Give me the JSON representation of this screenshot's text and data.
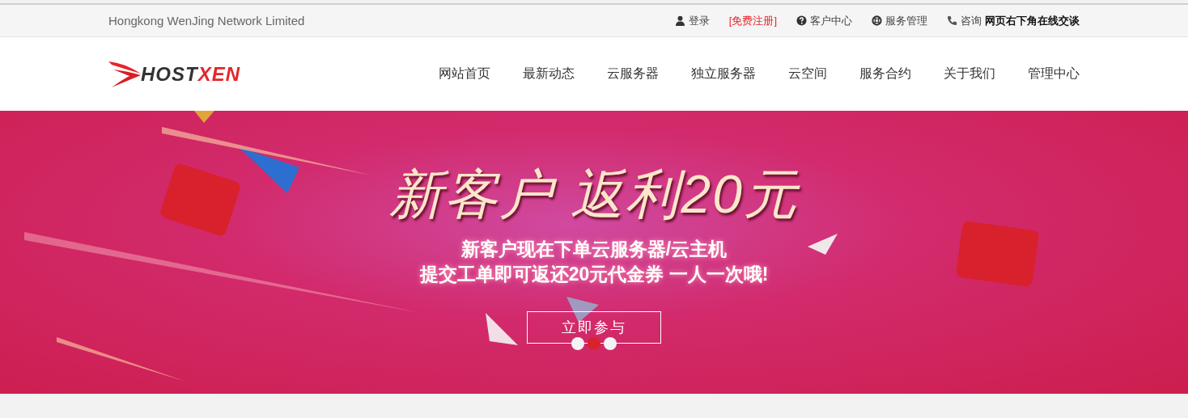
{
  "topbar": {
    "company": "Hongkong WenJing Network Limited",
    "links": [
      {
        "kind": "user",
        "label": "登录"
      },
      {
        "kind": "register",
        "label": "[免费注册]"
      },
      {
        "kind": "help",
        "label": "客户中心"
      },
      {
        "kind": "lifebuoy",
        "label": "服务管理"
      },
      {
        "kind": "phone",
        "label": "咨询",
        "strong": "网页右下角在线交谈"
      }
    ]
  },
  "logo": {
    "part1": "HOST",
    "part2": "XEN"
  },
  "nav": [
    "网站首页",
    "最新动态",
    "云服务器",
    "独立服务器",
    "云空间",
    "服务合约",
    "关于我们",
    "管理中心"
  ],
  "banner": {
    "headline": "新客户 返利20元",
    "line1": "新客户现在下单云服务器/云主机",
    "line2": "提交工单即可返还20元代金券 一人一次哦!",
    "button": "立即参与",
    "dots": [
      {
        "selected": false
      },
      {
        "selected": true
      },
      {
        "selected": false
      }
    ]
  }
}
